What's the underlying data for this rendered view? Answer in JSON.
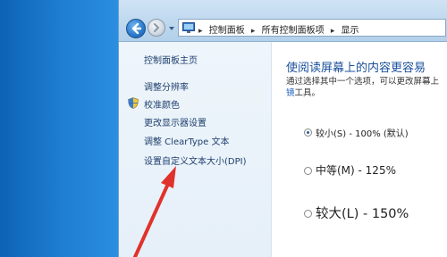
{
  "breadcrumb": {
    "items": [
      "控制面板",
      "所有控制面板项",
      "显示"
    ]
  },
  "sidebar": {
    "items": [
      {
        "label": "控制面板主页"
      },
      {
        "label": "调整分辨率"
      },
      {
        "label": "校准颜色"
      },
      {
        "label": "更改显示器设置"
      },
      {
        "label": "调整 ClearType 文本"
      },
      {
        "label": "设置自定义文本大小(DPI)"
      }
    ]
  },
  "main": {
    "heading": "使阅读屏幕上的内容更容易",
    "description": "通过选择其中一个选项，可以更改屏幕上",
    "description_link": "镜",
    "description_tail": "工具。",
    "options": [
      {
        "label": "较小(S) - 100% (默认)",
        "selected": true
      },
      {
        "label": "中等(M) - 125%",
        "selected": false
      },
      {
        "label": "较大(L) - 150%",
        "selected": false
      }
    ]
  },
  "colors": {
    "accent": "#1a4f9b",
    "annotation_arrow": "#e0322c"
  }
}
